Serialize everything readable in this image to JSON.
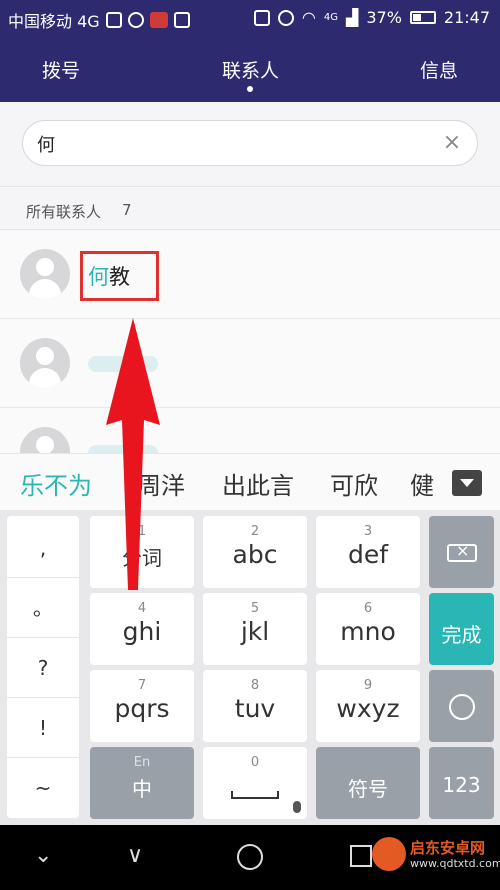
{
  "status_bar": {
    "carrier": "中国移动 4G",
    "battery": "37%",
    "time": "21:47",
    "net": "4G"
  },
  "nav": {
    "tabs": [
      "拨号",
      "联系人",
      "信息"
    ],
    "active": 1
  },
  "search": {
    "value": "何",
    "clear_icon": "clear-icon"
  },
  "section": {
    "label": "所有联系人",
    "count": "7"
  },
  "contacts": [
    {
      "highlight": "何",
      "rest": "教"
    }
  ],
  "candidates": [
    "乐不为",
    "周洋",
    "出此言",
    "可欣",
    "健"
  ],
  "symbols": [
    ",",
    "。",
    "?",
    "!",
    "~"
  ],
  "keys": {
    "k11": {
      "num": "1",
      "label": "分词"
    },
    "k12": {
      "num": "2",
      "label": "abc"
    },
    "k13": {
      "num": "3",
      "label": "def"
    },
    "k21": {
      "num": "4",
      "label": "ghi"
    },
    "k22": {
      "num": "5",
      "label": "jkl"
    },
    "k23": {
      "num": "6",
      "label": "mno"
    },
    "k24": {
      "label": "完成"
    },
    "k31": {
      "num": "7",
      "label": "pqrs"
    },
    "k32": {
      "num": "8",
      "label": "tuv"
    },
    "k33": {
      "num": "9",
      "label": "wxyz"
    },
    "k41": {
      "num": "En",
      "label": "中"
    },
    "k42": {
      "num": "0"
    },
    "k43": {
      "label": "符号"
    },
    "k44": {
      "label": "123"
    }
  },
  "watermark": {
    "name": "启东安卓网",
    "url": "www.qdtxtd.com"
  },
  "colors": {
    "topbar": "#2e2a70",
    "accent": "#2bb6b6",
    "annotation": "#e03030"
  }
}
